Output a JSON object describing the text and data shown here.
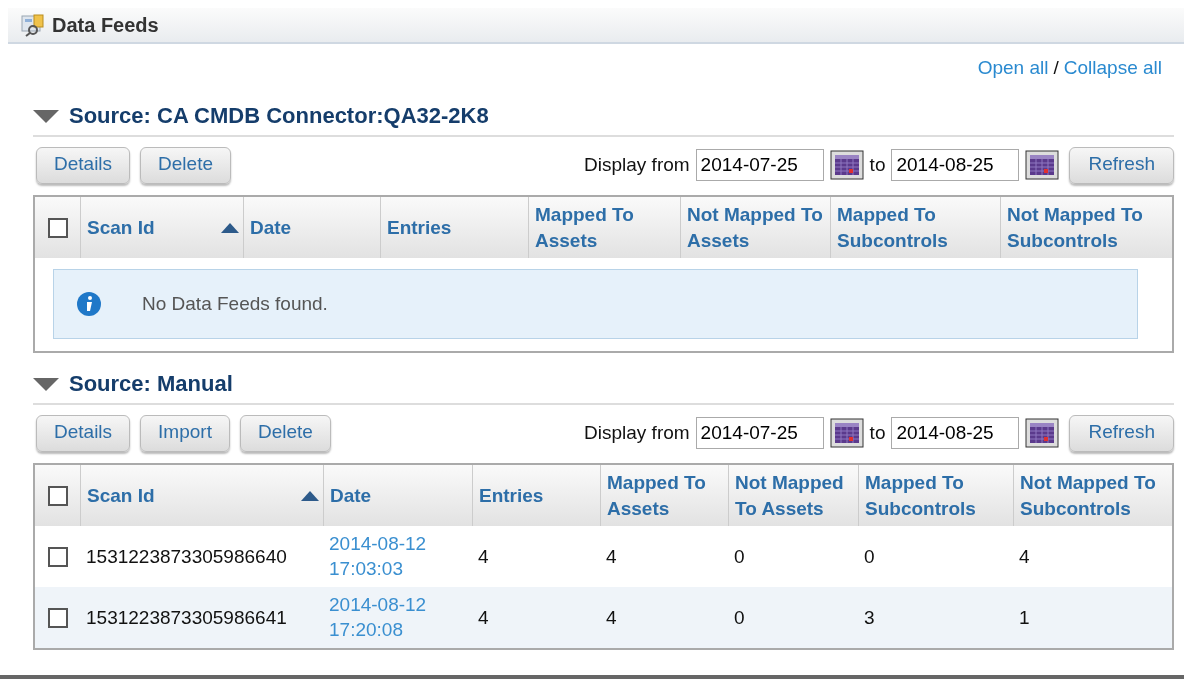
{
  "header": {
    "title": "Data Feeds"
  },
  "links": {
    "open_all": "Open all",
    "separator": "/",
    "collapse_all": "Collapse all"
  },
  "sections": [
    {
      "title": "Source: CA CMDB Connector:QA32-2K8",
      "expanded": true,
      "buttons": [
        "Details",
        "Delete"
      ],
      "display_from_label": "Display from",
      "from": "2014-07-25",
      "to_label": "to",
      "to": "2014-08-25",
      "refresh": "Refresh",
      "select_all_checked": false,
      "columns": [
        {
          "label": "Scan Id",
          "sorted": true
        },
        {
          "label": "Date",
          "sorted": false
        },
        {
          "label": "Entries",
          "sorted": false
        },
        {
          "label": "Mapped To Assets",
          "sorted": false
        },
        {
          "label": "Not Mapped To Assets",
          "sorted": false
        },
        {
          "label": "Mapped To Subcontrols",
          "sorted": false
        },
        {
          "label": "Not Mapped To Subcontrols",
          "sorted": false
        }
      ],
      "empty_message": "No Data Feeds found."
    },
    {
      "title": "Source: Manual",
      "expanded": true,
      "buttons": [
        "Details",
        "Import",
        "Delete"
      ],
      "display_from_label": "Display from",
      "from": "2014-07-25",
      "to_label": "to",
      "to": "2014-08-25",
      "refresh": "Refresh",
      "select_all_checked": false,
      "columns": [
        {
          "label": "Scan Id",
          "sorted": true
        },
        {
          "label": "Date",
          "sorted": false
        },
        {
          "label": "Entries",
          "sorted": false
        },
        {
          "label": "Mapped To Assets",
          "sorted": false
        },
        {
          "label": "Not Mapped To Assets",
          "sorted": false
        },
        {
          "label": "Mapped To Subcontrols",
          "sorted": false
        },
        {
          "label": "Not Mapped To Subcontrols",
          "sorted": false
        }
      ],
      "rows": [
        {
          "checked": false,
          "scan_id": "1531223873305986640",
          "date": "2014-08-12 17:03:03",
          "entries": "4",
          "mapped_assets": "4",
          "not_mapped_assets": "0",
          "mapped_subcontrols": "0",
          "not_mapped_subcontrols": "4"
        },
        {
          "checked": false,
          "scan_id": "1531223873305986641",
          "date": "2014-08-12 17:20:08",
          "entries": "4",
          "mapped_assets": "4",
          "not_mapped_assets": "0",
          "mapped_subcontrols": "3",
          "not_mapped_subcontrols": "1"
        }
      ]
    }
  ]
}
